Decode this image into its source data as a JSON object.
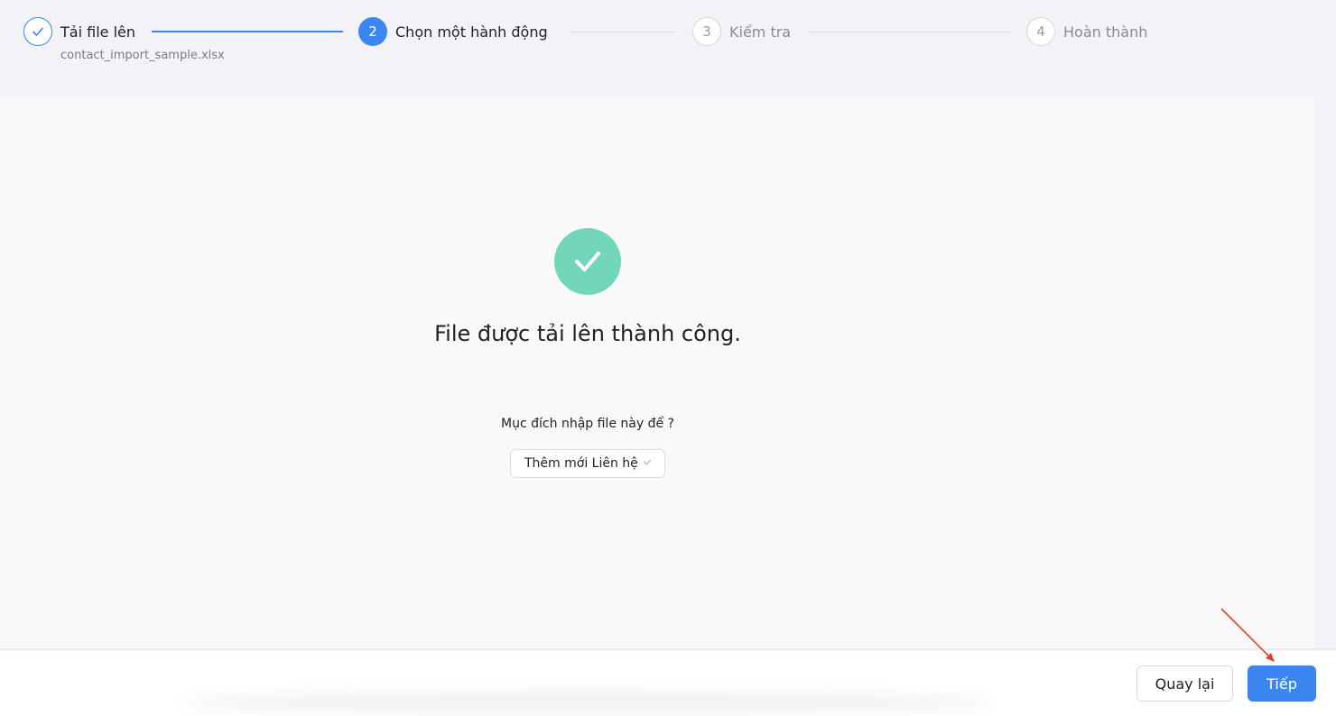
{
  "stepper": {
    "steps": [
      {
        "number": "",
        "label": "Tải file lên",
        "sublabel": "contact_import_sample.xlsx",
        "state": "done"
      },
      {
        "number": "2",
        "label": "Chọn một hành động",
        "state": "active"
      },
      {
        "number": "3",
        "label": "Kiểm tra",
        "state": "pending"
      },
      {
        "number": "4",
        "label": "Hoàn thành",
        "state": "pending"
      }
    ]
  },
  "main": {
    "success_title": "File được tải lên thành công.",
    "question": "Mục đích nhập file này để ?",
    "purpose_select": {
      "selected": "Thêm mới Liên hệ"
    }
  },
  "footer": {
    "back_label": "Quay lại",
    "next_label": "Tiếp"
  },
  "colors": {
    "accent": "#3b86f0",
    "success": "#72d6b8",
    "annotation_arrow": "#e0412b"
  }
}
